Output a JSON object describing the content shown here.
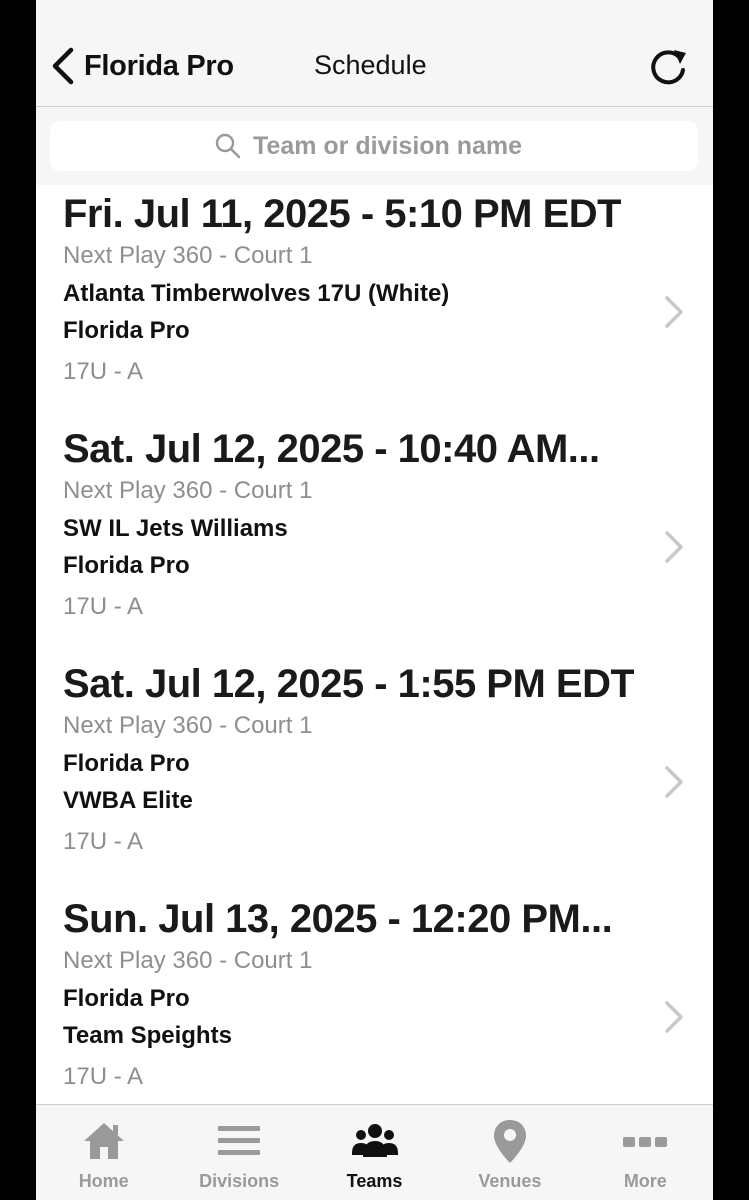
{
  "header": {
    "back_label": "Florida Pro",
    "title": "Schedule"
  },
  "search": {
    "placeholder": "Team or division name"
  },
  "games": [
    {
      "datetime": "Fri. Jul 11, 2025 - 5:10 PM EDT",
      "venue": "Next Play 360 - Court 1",
      "team1": "Atlanta Timberwolves 17U (White)",
      "team2": "Florida Pro",
      "division": "17U - A"
    },
    {
      "datetime": "Sat. Jul 12, 2025 - 10:40 AM...",
      "venue": "Next Play 360 - Court 1",
      "team1": "SW IL Jets Williams",
      "team2": "Florida Pro",
      "division": "17U - A"
    },
    {
      "datetime": "Sat. Jul 12, 2025 - 1:55 PM EDT",
      "venue": "Next Play 360 - Court 1",
      "team1": "Florida Pro",
      "team2": "VWBA Elite",
      "division": "17U - A"
    },
    {
      "datetime": "Sun. Jul 13, 2025 - 12:20 PM...",
      "venue": "Next Play 360 - Court 1",
      "team1": "Florida Pro",
      "team2": "Team Speights",
      "division": "17U - A"
    }
  ],
  "tabs": [
    {
      "label": "Home",
      "icon": "home-icon",
      "active": false
    },
    {
      "label": "Divisions",
      "icon": "menu-icon",
      "active": false
    },
    {
      "label": "Teams",
      "icon": "people-icon",
      "active": true
    },
    {
      "label": "Venues",
      "icon": "map-pin-icon",
      "active": false
    },
    {
      "label": "More",
      "icon": "more-dots-icon",
      "active": false
    }
  ],
  "colors": {
    "text_dark": "#111111",
    "text_muted": "#8e8e8e",
    "chrome_bg": "#f6f6f6",
    "tab_inactive": "#9a9a9a"
  }
}
